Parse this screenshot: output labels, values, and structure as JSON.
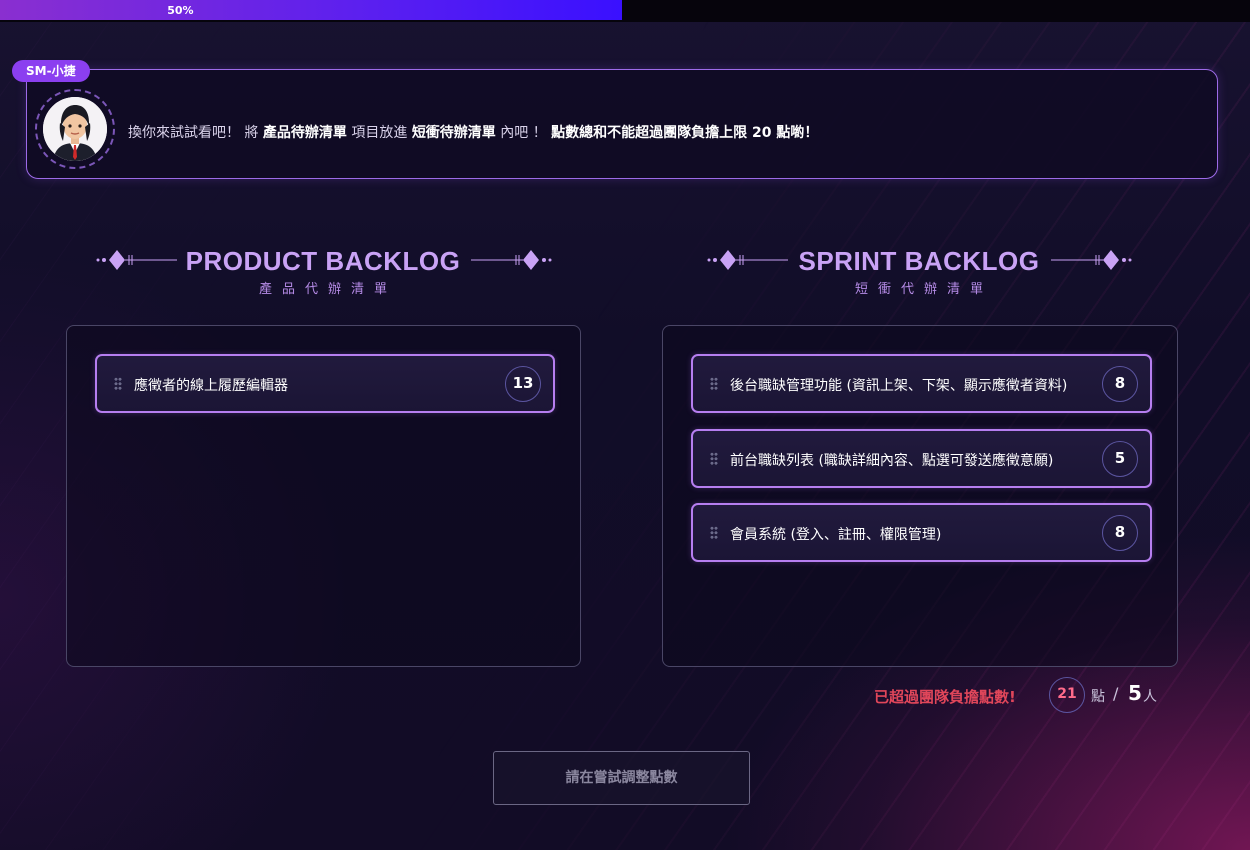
{
  "progress": {
    "value": 0.5,
    "label": "50%"
  },
  "dialog": {
    "speaker": "SM-小捷",
    "avatar_icon": "person-avatar",
    "text": [
      {
        "t": "換你來試試看吧！ 將 ",
        "bold": false
      },
      {
        "t": "產品待辦清單",
        "bold": true
      },
      {
        "t": " 項目放進 ",
        "bold": false
      },
      {
        "t": "短衝待辦清單",
        "bold": true
      },
      {
        "t": " 內吧 ！ ",
        "bold": false
      },
      {
        "t": "點數總和不能超過團隊負擔上限 20 點喲！",
        "bold": true
      }
    ]
  },
  "product_backlog": {
    "title": "PRODUCT BACKLOG",
    "subtitle": "產品代辦清單",
    "items": [
      {
        "label": "應徵者的線上履歷編輯器",
        "points": "13"
      }
    ]
  },
  "sprint_backlog": {
    "title": "SPRINT BACKLOG",
    "subtitle": "短衝代辦清單",
    "items": [
      {
        "label": "後台職缺管理功能 (資訊上架、下架、顯示應徵者資料)",
        "points": "8"
      },
      {
        "label": "前台職缺列表 (職缺詳細內容、點選可發送應徵意願)",
        "points": "5"
      },
      {
        "label": "會員系統 (登入、註冊、權限管理)",
        "points": "8"
      }
    ]
  },
  "summary": {
    "warning": "已超過團隊負擔點數!",
    "total_points": "21",
    "points_unit": "點",
    "separator": "/",
    "team_size": "5",
    "team_unit": "人"
  },
  "retry_button": {
    "label": "請在嘗試調整點數"
  },
  "colors": {
    "accent": "#b67ef0",
    "title": "#c9a2f5",
    "warning": "#e0465a",
    "tag": "#8b3ff0"
  }
}
